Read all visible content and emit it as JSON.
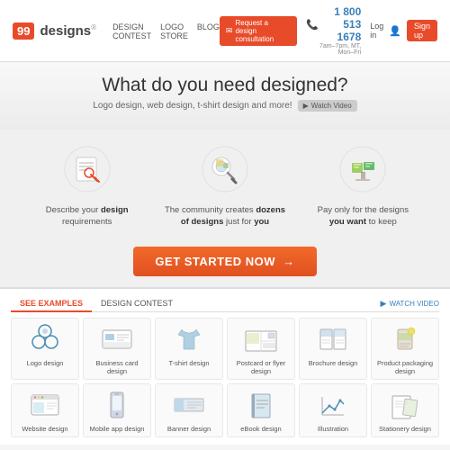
{
  "header": {
    "logo_number": "99",
    "logo_brand": "designs",
    "logo_reg": "®",
    "nav": [
      {
        "label": "DESIGN CONTEST"
      },
      {
        "label": "LOGO STORE"
      },
      {
        "label": "BLOG"
      }
    ],
    "consult_label": "Request a design consultation",
    "phone": "1 800 513 1678",
    "phone_sub": "7am–7pm, MT, Mon–Fri",
    "login_label": "Log in",
    "signup_label": "Sign up"
  },
  "hero": {
    "title_prefix": "What do you need ",
    "title_suffix": "designed?",
    "subtitle": "Logo design, web design, t-shirt design and more!",
    "watch_video_label": "Watch Video"
  },
  "steps": [
    {
      "text_before": "Describe your ",
      "text_bold": "design",
      "text_after": "\nrequirements",
      "label": "Describe your design requirements"
    },
    {
      "text_before": "The community creates ",
      "text_bold": "dozens\nof designs",
      "text_after": " just for ",
      "text_you": "you",
      "label": "The community creates dozens of designs just for you"
    },
    {
      "text_before": "Pay only for the designs\n",
      "text_bold": "you want",
      "text_after": " to keep",
      "label": "Pay only for the designs you want to keep"
    }
  ],
  "cta": {
    "button_label": "GET STARTED NOW",
    "arrow": "→"
  },
  "examples": {
    "tab_examples": "SEE EXAMPLES",
    "tab_contest": "DESIGN CONTEST",
    "watch_video": "WATCH VIDEO",
    "designs": [
      {
        "label": "Logo design",
        "icon": "logo"
      },
      {
        "label": "Business card design",
        "icon": "business-card"
      },
      {
        "label": "T-shirt design",
        "icon": "tshirt"
      },
      {
        "label": "Postcard or flyer design",
        "icon": "postcard"
      },
      {
        "label": "Brochure design",
        "icon": "brochure"
      },
      {
        "label": "Product packaging design",
        "icon": "packaging"
      },
      {
        "label": "Website design",
        "icon": "website"
      },
      {
        "label": "Mobile app design",
        "icon": "mobile"
      },
      {
        "label": "Banner design",
        "icon": "banner"
      },
      {
        "label": "eBook design",
        "icon": "ebook"
      },
      {
        "label": "Illustration",
        "icon": "illustration"
      },
      {
        "label": "Stationery design",
        "icon": "stationery"
      }
    ]
  },
  "colors": {
    "brand_orange": "#e84b2a",
    "brand_blue": "#3a7fba",
    "text_dark": "#333",
    "text_mid": "#555",
    "bg_light": "#f0f0f0"
  }
}
